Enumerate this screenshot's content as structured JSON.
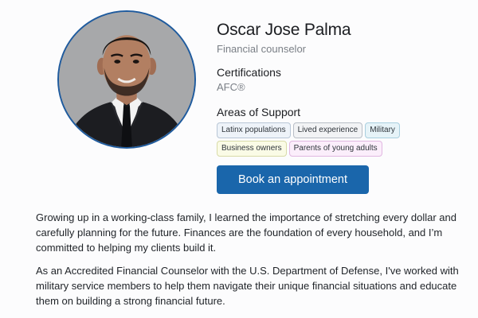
{
  "profile": {
    "name": "Oscar Jose Palma",
    "role": "Financial counselor"
  },
  "certifications": {
    "heading": "Certifications",
    "value": "AFC®"
  },
  "areas": {
    "heading": "Areas of Support",
    "tags": [
      {
        "label": "Latinx populations",
        "color": "#eef3f9"
      },
      {
        "label": "Lived experience",
        "color": "#f2f3f5"
      },
      {
        "label": "Military",
        "color": "#e6f3f8"
      },
      {
        "label": "Business owners",
        "color": "#fafbe6"
      },
      {
        "label": "Parents of young adults",
        "color": "#fbeefb"
      }
    ]
  },
  "cta": {
    "label": "Book an appointment",
    "color": "#1a66ab"
  },
  "bio": {
    "paragraphs": [
      "Growing up in a working-class family, I learned the importance of stretching every dollar and carefully planning for the future. Finances are the foundation of every household, and I’m committed to helping my clients build it.",
      "As an Accredited Financial Counselor with the U.S. Department of Defense, I've worked with military service members to help them navigate their unique financial situations and educate them on building a strong financial future."
    ]
  }
}
